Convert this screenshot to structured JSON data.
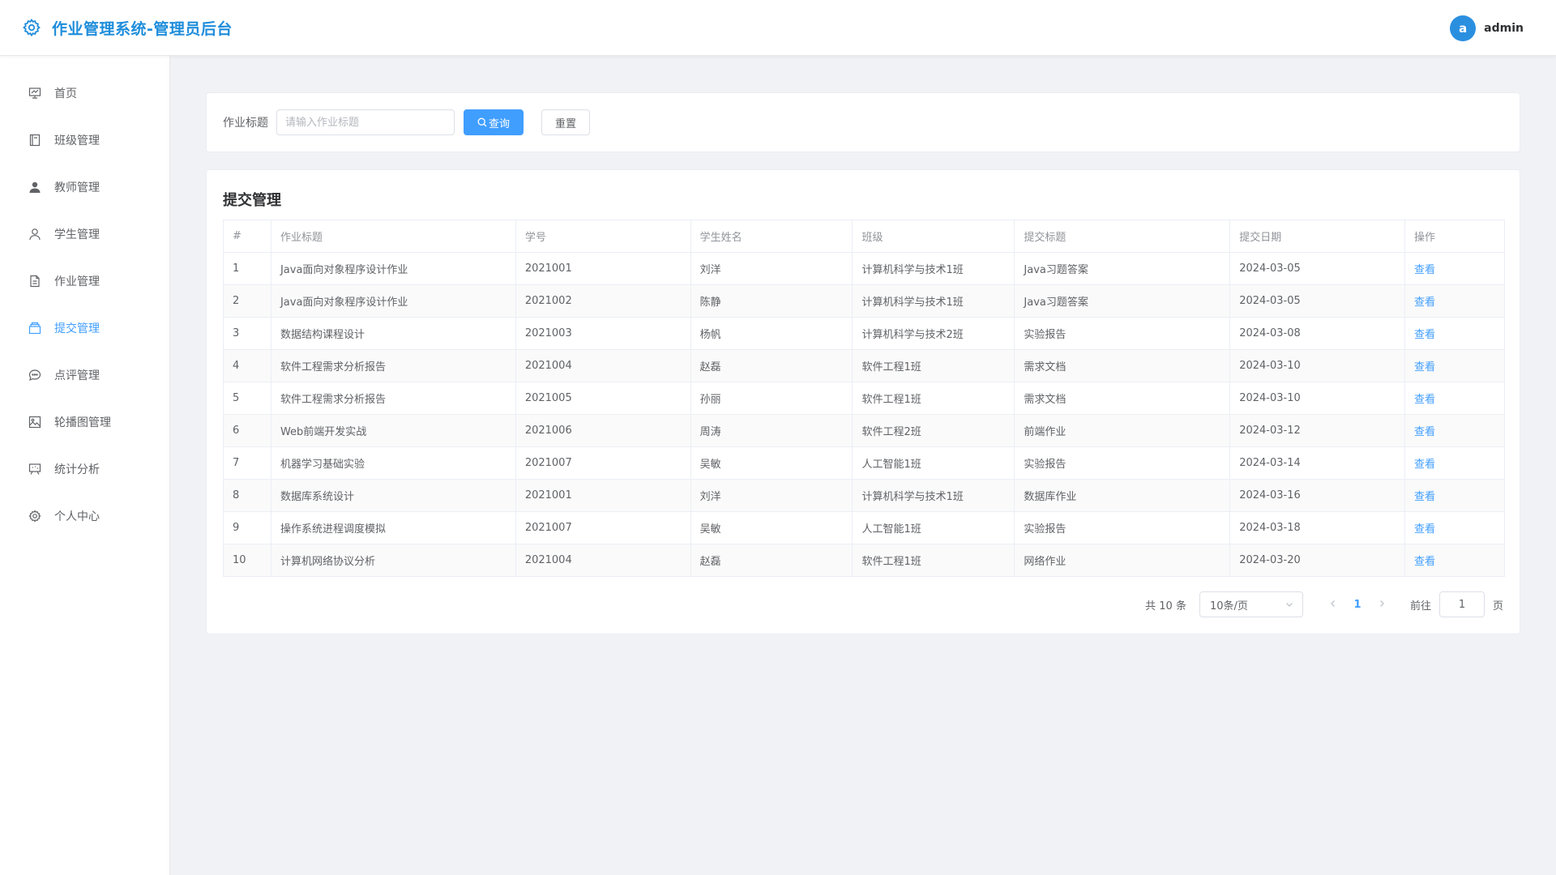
{
  "header": {
    "title": "作业管理系统-管理员后台",
    "avatar_letter": "a",
    "username": "admin",
    "logo_icon": "gear-icon",
    "accent": "#1f8ddb"
  },
  "sidebar": {
    "items": [
      {
        "label": "首页",
        "icon": "presentation-icon",
        "active": false
      },
      {
        "label": "班级管理",
        "icon": "notebook-icon",
        "active": false
      },
      {
        "label": "教师管理",
        "icon": "user-solid-icon",
        "active": false
      },
      {
        "label": "学生管理",
        "icon": "user-icon",
        "active": false
      },
      {
        "label": "作业管理",
        "icon": "document-icon",
        "active": false
      },
      {
        "label": "提交管理",
        "icon": "box-icon",
        "active": true
      },
      {
        "label": "点评管理",
        "icon": "chat-icon",
        "active": false
      },
      {
        "label": "轮播图管理",
        "icon": "picture-icon",
        "active": false
      },
      {
        "label": "统计分析",
        "icon": "data-board-icon",
        "active": false
      },
      {
        "label": "个人中心",
        "icon": "setting-icon",
        "active": false
      }
    ]
  },
  "search": {
    "label": "作业标题",
    "placeholder": "请输入作业标题",
    "value": "",
    "query_button": "查询",
    "reset_button": "重置"
  },
  "table": {
    "title": "提交管理",
    "columns": [
      "#",
      "作业标题",
      "学号",
      "学生姓名",
      "班级",
      "提交标题",
      "提交日期",
      "操作"
    ],
    "rows": [
      {
        "no": "1",
        "homework": "Java面向对象程序设计作业",
        "sid": "2021001",
        "name": "刘洋",
        "cls": "计算机科学与技术1班",
        "sub_title": "Java习题答案",
        "date": "2024-03-05",
        "action": "查看"
      },
      {
        "no": "2",
        "homework": "Java面向对象程序设计作业",
        "sid": "2021002",
        "name": "陈静",
        "cls": "计算机科学与技术1班",
        "sub_title": "Java习题答案",
        "date": "2024-03-05",
        "action": "查看"
      },
      {
        "no": "3",
        "homework": "数据结构课程设计",
        "sid": "2021003",
        "name": "杨帆",
        "cls": "计算机科学与技术2班",
        "sub_title": "实验报告",
        "date": "2024-03-08",
        "action": "查看"
      },
      {
        "no": "4",
        "homework": "软件工程需求分析报告",
        "sid": "2021004",
        "name": "赵磊",
        "cls": "软件工程1班",
        "sub_title": "需求文档",
        "date": "2024-03-10",
        "action": "查看"
      },
      {
        "no": "5",
        "homework": "软件工程需求分析报告",
        "sid": "2021005",
        "name": "孙丽",
        "cls": "软件工程1班",
        "sub_title": "需求文档",
        "date": "2024-03-10",
        "action": "查看"
      },
      {
        "no": "6",
        "homework": "Web前端开发实战",
        "sid": "2021006",
        "name": "周涛",
        "cls": "软件工程2班",
        "sub_title": "前端作业",
        "date": "2024-03-12",
        "action": "查看"
      },
      {
        "no": "7",
        "homework": "机器学习基础实验",
        "sid": "2021007",
        "name": "吴敏",
        "cls": "人工智能1班",
        "sub_title": "实验报告",
        "date": "2024-03-14",
        "action": "查看"
      },
      {
        "no": "8",
        "homework": "数据库系统设计",
        "sid": "2021001",
        "name": "刘洋",
        "cls": "计算机科学与技术1班",
        "sub_title": "数据库作业",
        "date": "2024-03-16",
        "action": "查看"
      },
      {
        "no": "9",
        "homework": "操作系统进程调度模拟",
        "sid": "2021007",
        "name": "吴敏",
        "cls": "人工智能1班",
        "sub_title": "实验报告",
        "date": "2024-03-18",
        "action": "查看"
      },
      {
        "no": "10",
        "homework": "计算机网络协议分析",
        "sid": "2021004",
        "name": "赵磊",
        "cls": "软件工程1班",
        "sub_title": "网络作业",
        "date": "2024-03-20",
        "action": "查看"
      }
    ]
  },
  "pagination": {
    "total_text": "共 10 条",
    "page_size": "10条/页",
    "current_page": "1",
    "goto_label": "前往",
    "goto_value": "1",
    "page_unit": "页"
  }
}
